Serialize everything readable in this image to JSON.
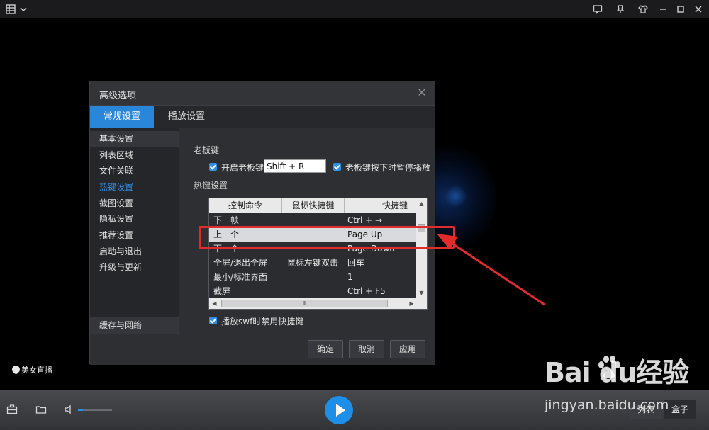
{
  "topbar": {
    "menu_icon": "grid-menu-icon",
    "right_icons": [
      "message-icon",
      "pin-icon",
      "skin-icon",
      "minimize-icon",
      "maximize-icon",
      "close-icon"
    ]
  },
  "dialog": {
    "title": "高级选项",
    "tabs": [
      {
        "label": "常规设置",
        "active": true
      },
      {
        "label": "播放设置",
        "active": false
      }
    ],
    "sidebar": {
      "items": [
        "基本设置",
        "列表区域",
        "文件关联",
        "热键设置",
        "截图设置",
        "隐私设置",
        "推荐设置",
        "启动与退出",
        "升级与更新"
      ],
      "active_index": 3,
      "bottom_item": "缓存与网络"
    },
    "boss_key": {
      "section": "老板键",
      "enable_label": "开启老板键",
      "key_value": "Shift + R",
      "pause_label": "老板键按下时暂停播放"
    },
    "hotkeys": {
      "section": "热键设置",
      "columns": [
        "控制命令",
        "鼠标快捷键",
        "快捷键"
      ],
      "rows": [
        {
          "cmd": "下一帧",
          "mouse": "",
          "key": "Ctrl + →"
        },
        {
          "cmd": "上一个",
          "mouse": "",
          "key": "Page Up"
        },
        {
          "cmd": "下一个",
          "mouse": "",
          "key": "Page Down"
        },
        {
          "cmd": "全屏/退出全屏",
          "mouse": "鼠标左键双击",
          "key": "回车"
        },
        {
          "cmd": "最小/标准界面",
          "mouse": "",
          "key": "1"
        },
        {
          "cmd": "截屏",
          "mouse": "",
          "key": "Ctrl + F5"
        }
      ],
      "selected_row": 1,
      "scroll_thumb_label": "Ⅲ"
    },
    "swf_label": "播放swf时禁用快捷键",
    "buttons": {
      "ok": "确定",
      "cancel": "取消",
      "apply": "应用"
    }
  },
  "live_label": "美女直播",
  "bottombar": {
    "volume_percent": 15,
    "list_label": "列表",
    "box_label": "盒子"
  },
  "watermark": {
    "brand": "Bai  du经验",
    "url": "jingyan.baidu.com"
  },
  "colors": {
    "accent": "#2a86d8",
    "highlight": "#e22b2b"
  }
}
